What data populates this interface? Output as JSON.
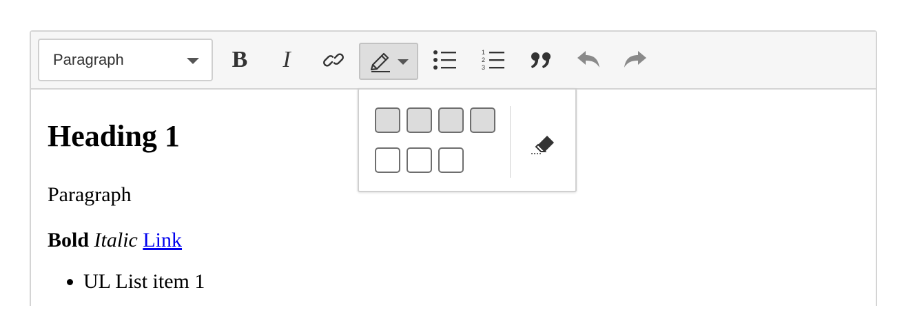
{
  "toolbar": {
    "heading_value": "Paragraph",
    "bold_label": "B",
    "italic_label": "I"
  },
  "content": {
    "heading": "Heading 1",
    "paragraph": "Paragraph",
    "bold_text": "Bold",
    "italic_text": "Italic",
    "link_text": "Link",
    "list_item_1": "UL List item 1"
  },
  "icons": [
    "chevron-down-icon",
    "link-icon",
    "pencil-icon",
    "bulleted-list-icon",
    "numbered-list-icon",
    "quote-icon",
    "undo-icon",
    "redo-icon",
    "eraser-icon"
  ],
  "colors": {
    "toolbar_bg": "#f6f6f6",
    "link": "#0000ee",
    "active_button": "#dedede"
  }
}
